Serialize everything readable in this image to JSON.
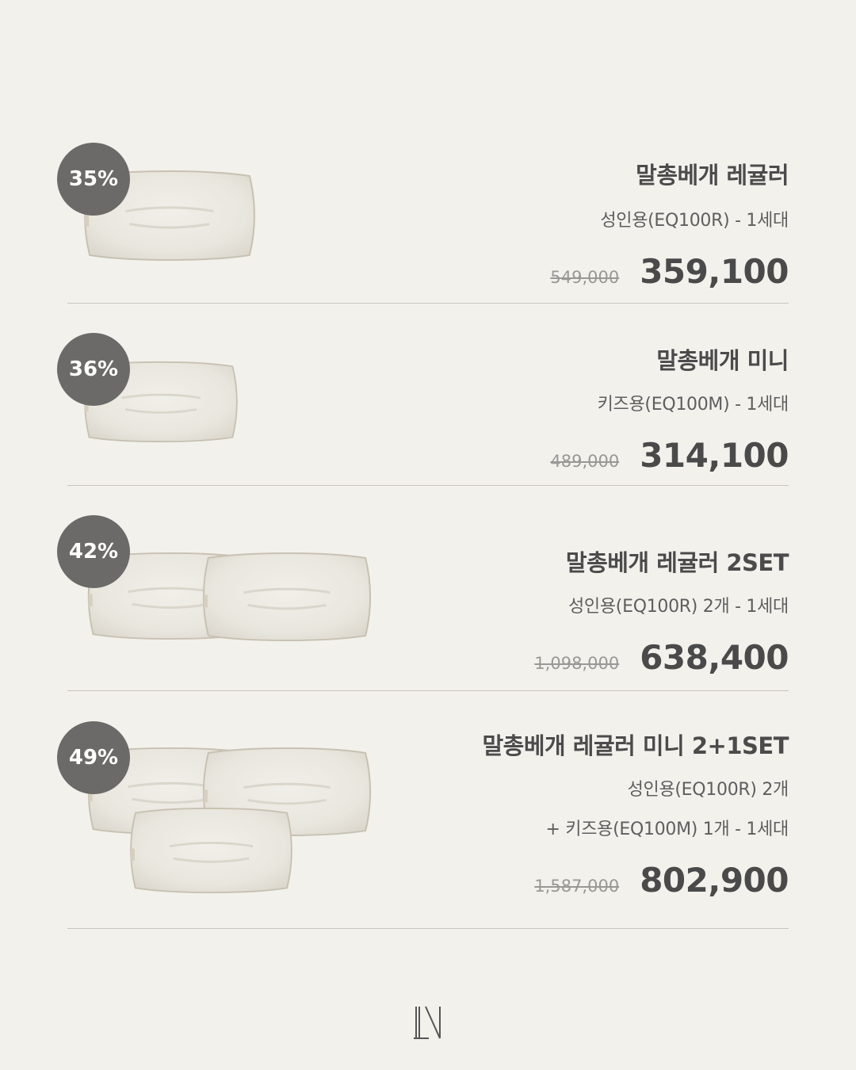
{
  "products": [
    {
      "discount": "35%",
      "name": "말총베개 레귤러",
      "sub1": "성인용(EQ100R)  - 1세대",
      "old_price": "549,000",
      "price": "359,100"
    },
    {
      "discount": "36%",
      "name": "말총베개 미니",
      "sub1": "키즈용(EQ100M)  - 1세대",
      "old_price": "489,000",
      "price": "314,100"
    },
    {
      "discount": "42%",
      "name": "말총베개 레귤러 2SET",
      "sub1": "성인용(EQ100R) 2개  - 1세대",
      "old_price": "1,098,000",
      "price": "638,400"
    },
    {
      "discount": "49%",
      "name": "말총베개 레귤러 미니 2+1SET",
      "sub1": "성인용(EQ100R) 2개",
      "sub2": "+ 키즈용(EQ100M) 1개  - 1세대",
      "old_price": "1,587,000",
      "price": "802,900"
    }
  ],
  "icons": {
    "product_image": "pillow-image",
    "brand": "ln-logo"
  },
  "colors": {
    "background": "#f3f1ec",
    "badge": "#6b6a68",
    "pillow": "#ebe8e0",
    "divider": "#c9c6c0"
  }
}
